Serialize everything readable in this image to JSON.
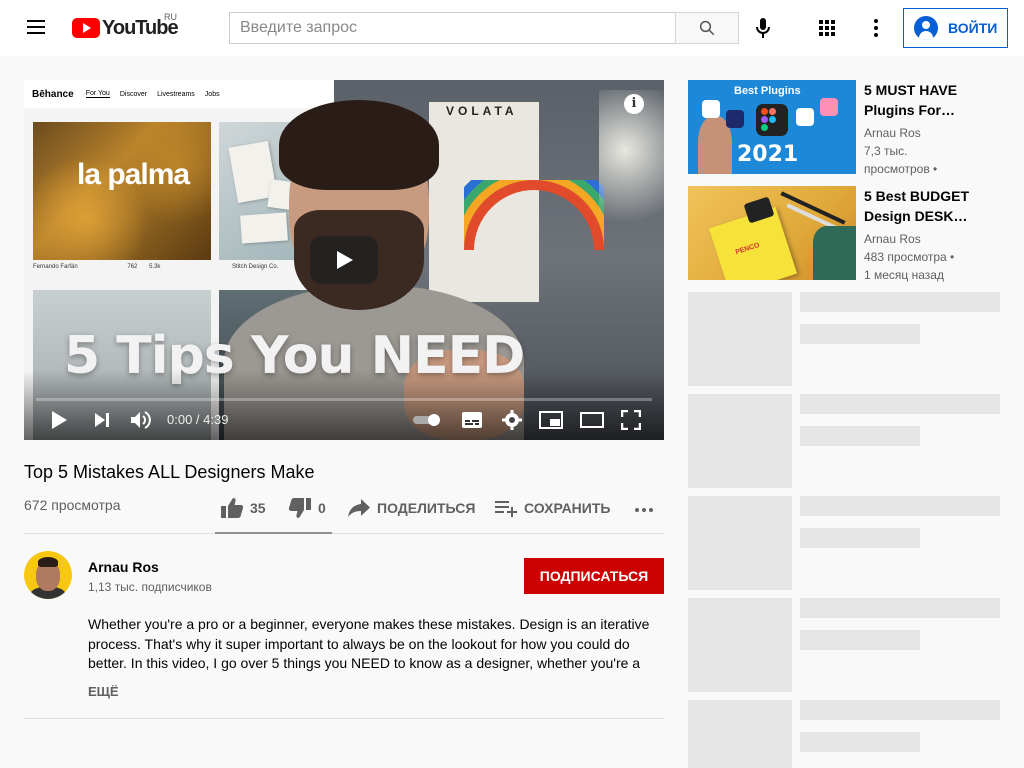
{
  "header": {
    "logo_text": "YouTube",
    "region": "RU",
    "search_placeholder": "Введите запрос",
    "signin_label": "ВОЙТИ"
  },
  "player": {
    "video_title_overlay": "5 Tips You NEED",
    "current_time": "0:00",
    "duration": "4:39",
    "time_separator": " / ",
    "progress_fraction": 0.0,
    "thumbnail": {
      "behance_logo": "Bēhance",
      "nav": [
        "For You",
        "Discover",
        "Livestreams",
        "Jobs"
      ],
      "tile1_text": "la palma",
      "tile1_author": "Fernando Farfán",
      "tile1_likes": "762",
      "tile1_views": "5.3k",
      "tile2_author": "Stitch Design Co.",
      "poster_text": "VOLATA"
    }
  },
  "video": {
    "title": "Top 5 Mistakes ALL Designers Make",
    "views": "672 просмотра",
    "likes": "35",
    "dislikes": "0",
    "share_label": "ПОДЕЛИТЬСЯ",
    "save_label": "СОХРАНИТЬ"
  },
  "channel": {
    "name": "Arnau Ros",
    "subscribers": "1,13 тыс. подписчиков",
    "subscribe_label": "ПОДПИСАТЬСЯ"
  },
  "description": {
    "text": "Whether you're a pro or a beginner, everyone makes these mistakes. Design is an iterative process. That's why it super important to always be on the lookout for how you could do better. In this video, I go over 5 things you NEED to know as a designer, whether you're a",
    "more_label": "ЕЩЁ"
  },
  "recommendations": [
    {
      "title_line1": "5 MUST HAVE",
      "title_line2": "Plugins For…",
      "channel": "Arnau Ros",
      "views_line1": "7,3 тыс.",
      "views_line2": "просмотров •",
      "thumb_title": "Best Plugins",
      "thumb_year": "2021"
    },
    {
      "title_line1": "5 Best BUDGET",
      "title_line2": "Design DESK…",
      "channel": "Arnau Ros",
      "views_line1": "483 просмотра •",
      "views_line2": "1 месяц назад",
      "thumb_brand": "PENCO"
    }
  ],
  "colors": {
    "brand_red": "#ff0000",
    "subscribe_red": "#cc0000",
    "link_blue": "#065fd4"
  },
  "icons": [
    "menu-icon",
    "youtube-logo-icon",
    "search-icon",
    "microphone-icon",
    "apps-grid-icon",
    "more-vert-icon",
    "account-icon",
    "info-icon",
    "play-icon",
    "next-icon",
    "volume-icon",
    "autoplay-toggle-icon",
    "subtitles-icon",
    "settings-icon",
    "miniplayer-icon",
    "theater-icon",
    "fullscreen-icon",
    "thumb-up-icon",
    "thumb-down-icon",
    "share-icon",
    "save-playlist-icon",
    "more-horiz-icon"
  ]
}
